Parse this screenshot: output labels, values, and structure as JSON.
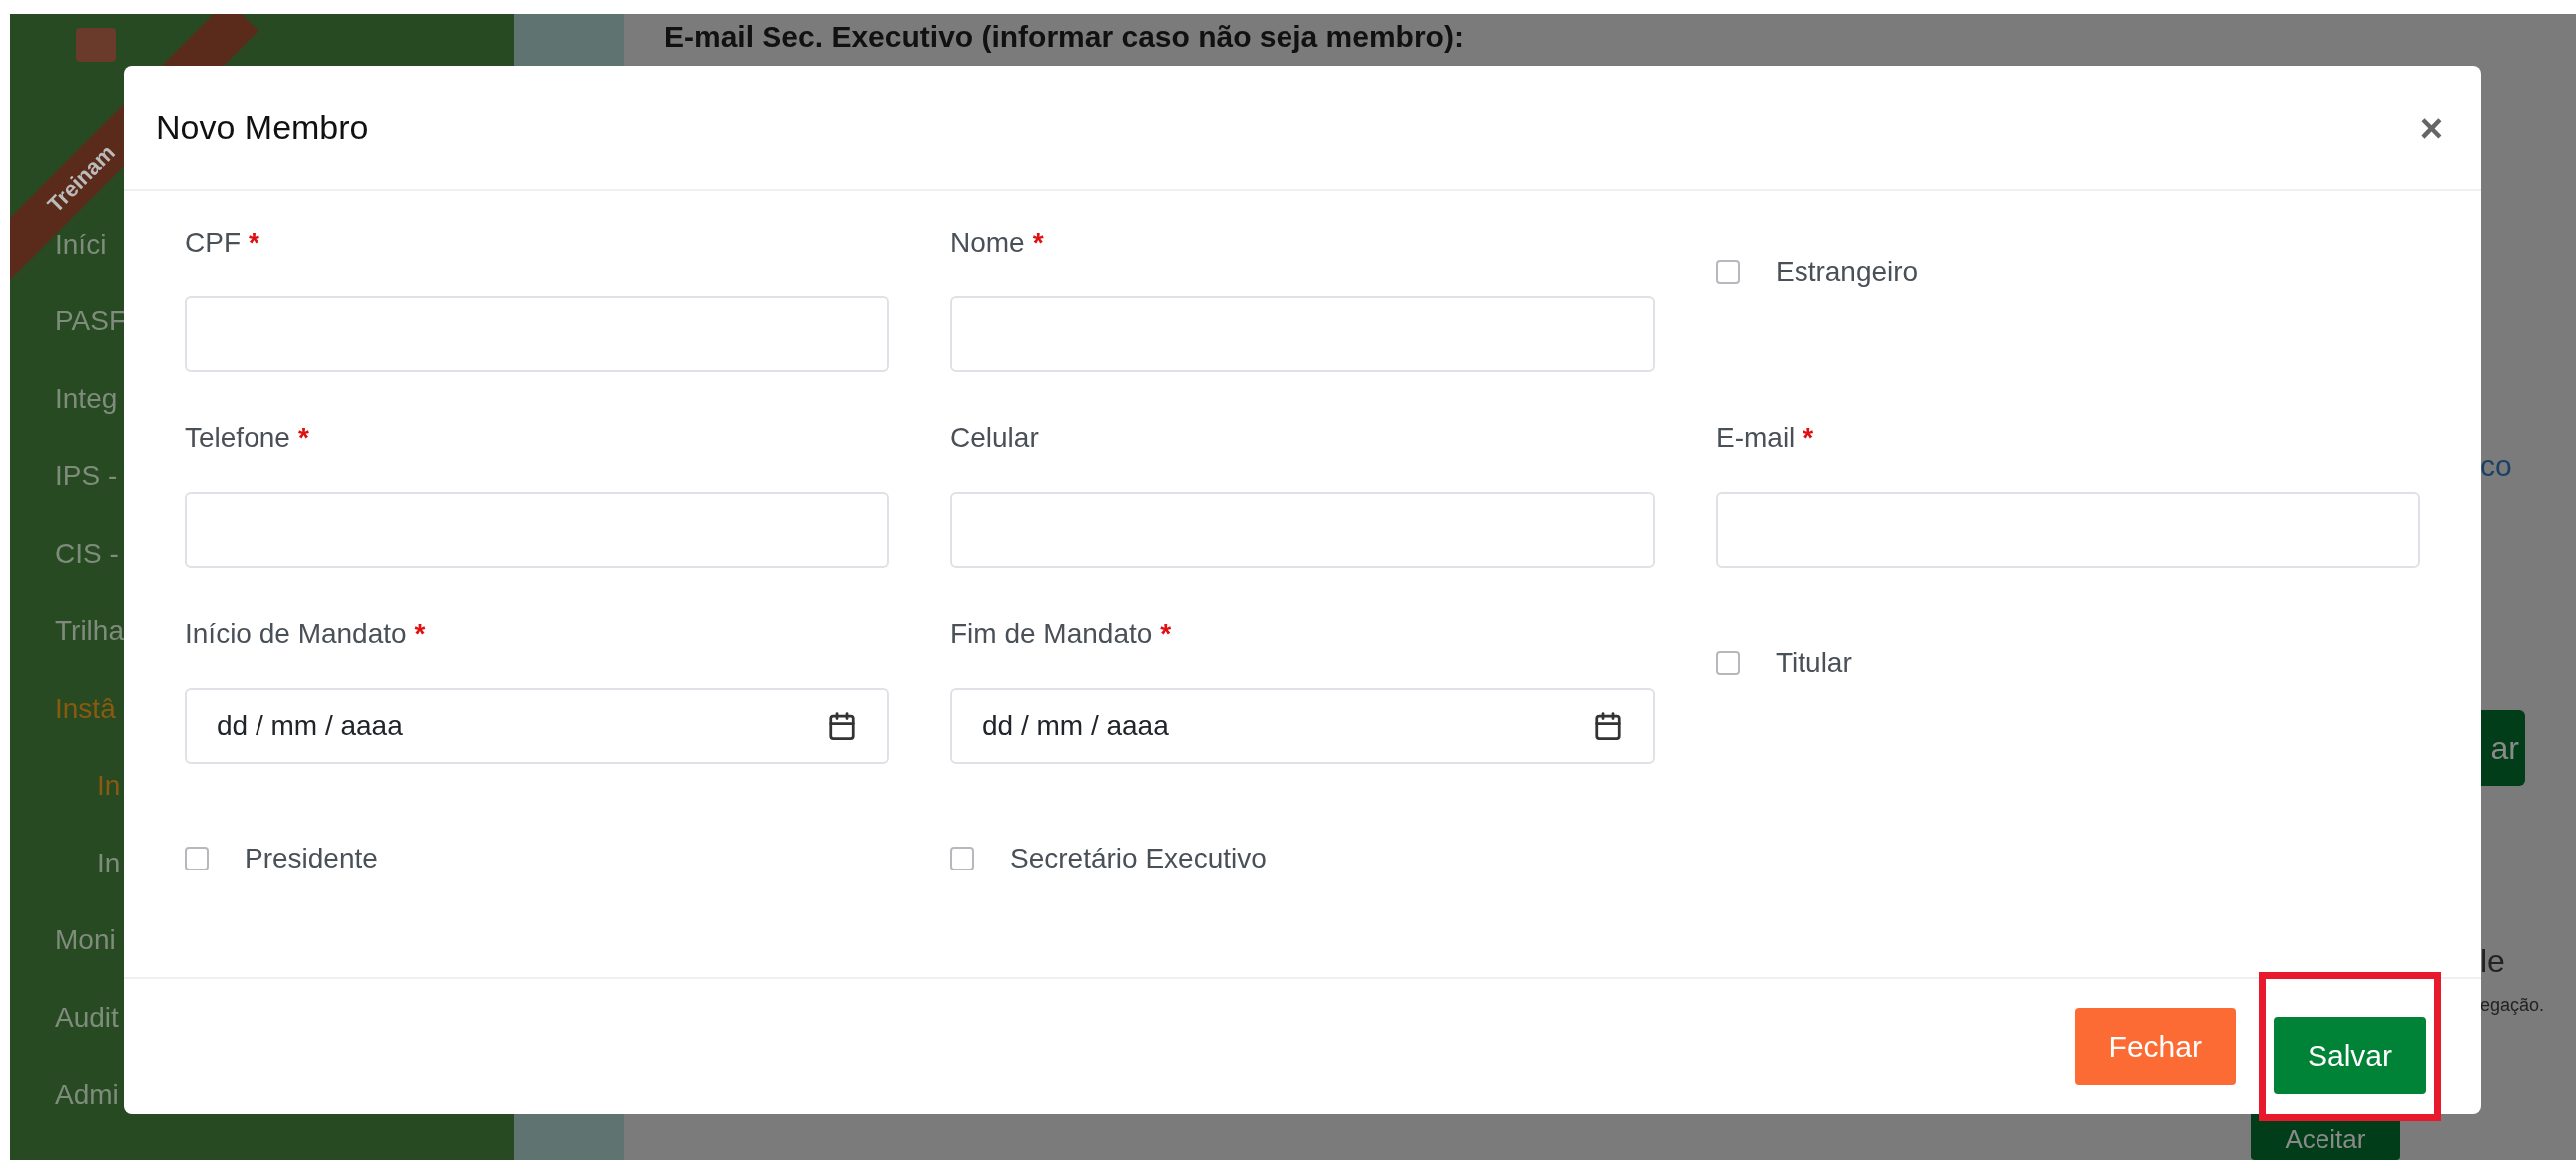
{
  "background": {
    "ribbon": "Treinam",
    "sidebar": [
      {
        "label": "Iníci",
        "selected": false,
        "sub": false
      },
      {
        "label": "PASF",
        "selected": false,
        "sub": false
      },
      {
        "label": "Integ",
        "selected": false,
        "sub": false
      },
      {
        "label": "IPS -",
        "selected": false,
        "sub": false
      },
      {
        "label": "CIS -",
        "selected": false,
        "sub": false
      },
      {
        "label": "Trilha",
        "selected": false,
        "sub": false
      },
      {
        "label": "Instâ",
        "selected": true,
        "sub": false
      },
      {
        "label": "In",
        "selected": true,
        "sub": true
      },
      {
        "label": "In",
        "selected": false,
        "sub": true
      },
      {
        "label": "Moni",
        "selected": false,
        "sub": false
      },
      {
        "label": "Audit",
        "selected": false,
        "sub": false
      },
      {
        "label": "Admi",
        "selected": false,
        "sub": false
      }
    ],
    "heading": "E-mail Sec. Executivo (informar caso não seja membro):",
    "right_texts": [
      "co",
      "ar",
      "le",
      "egação.",
      "Aceitar"
    ]
  },
  "modal": {
    "title": "Novo Membro",
    "close": "×",
    "rows": [
      [
        {
          "kind": "field",
          "label": "CPF",
          "required_mark": "*"
        },
        {
          "kind": "field",
          "label": "Nome",
          "required_mark": "*"
        },
        {
          "kind": "checkbox",
          "label": "Estrangeiro",
          "checked": false
        }
      ],
      [
        {
          "kind": "field",
          "label": "Telefone",
          "required_mark": "*"
        },
        {
          "kind": "field",
          "label": "Celular"
        },
        {
          "kind": "field",
          "label": "E-mail",
          "required_mark": "*"
        }
      ],
      [
        {
          "kind": "date",
          "label": "Início de Mandato",
          "required_mark": "*",
          "placeholder": "dd / mm / aaaa"
        },
        {
          "kind": "date",
          "label": "Fim de Mandato",
          "required_mark": "*",
          "placeholder": "dd / mm / aaaa"
        },
        {
          "kind": "checkbox",
          "label": "Titular",
          "checked": false
        }
      ],
      [
        {
          "kind": "checkbox",
          "label": "Presidente",
          "checked": false
        },
        {
          "kind": "checkbox",
          "label": "Secretário Executivo",
          "checked": false
        }
      ]
    ],
    "buttons": [
      {
        "label": "Fechar",
        "kind": "secondary",
        "highlighted": false
      },
      {
        "label": "Salvar",
        "kind": "primary",
        "highlighted": true
      }
    ]
  }
}
